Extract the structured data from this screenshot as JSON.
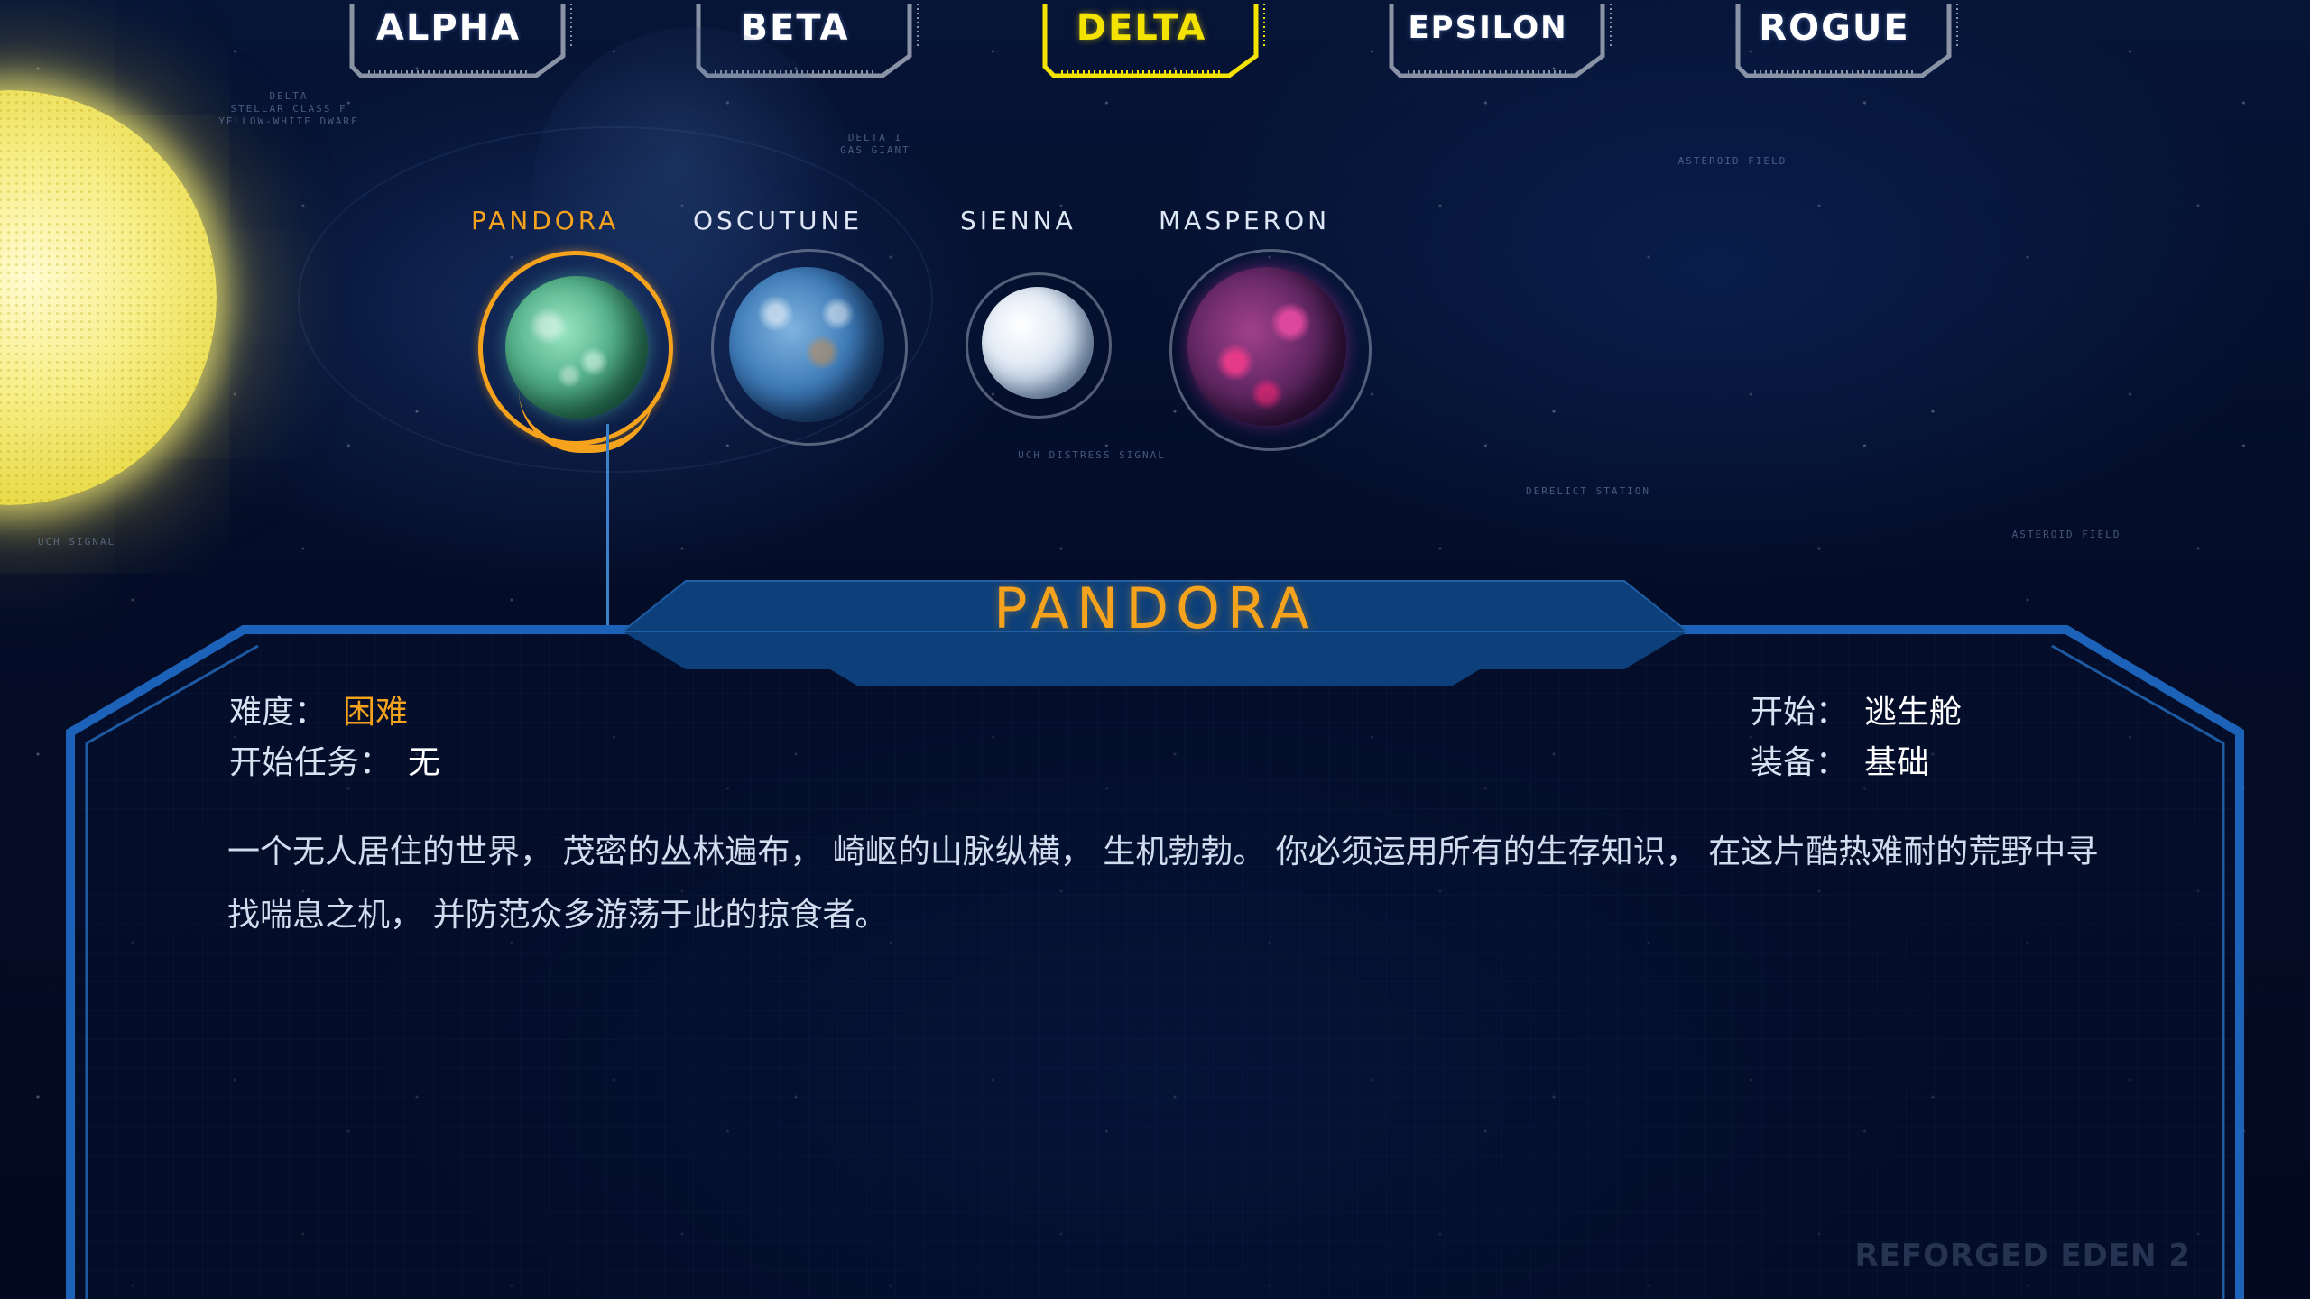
{
  "systems": [
    {
      "label": "ALPHA",
      "active": false
    },
    {
      "label": "BETA",
      "active": false
    },
    {
      "label": "DELTA",
      "active": true
    },
    {
      "label": "EPSILON",
      "active": false
    },
    {
      "label": "ROGUE",
      "active": false
    }
  ],
  "map_labels": {
    "star": "DELTA\nSTELLAR CLASS F\nYELLOW-WHITE DWARF",
    "gas_giant": "DELTA I\nGAS GIANT",
    "asteroid_field_1": "ASTEROID FIELD",
    "asteroid_field_2": "ASTEROID FIELD",
    "derelict_station": "DERELICT STATION",
    "uch_distress": "UCH DISTRESS SIGNAL",
    "uch_signal": "UCH SIGNAL"
  },
  "planets": [
    {
      "name": "PANDORA",
      "selected": true
    },
    {
      "name": "OSCUTUNE",
      "selected": false
    },
    {
      "name": "SIENNA",
      "selected": false
    },
    {
      "name": "MASPERON",
      "selected": false
    }
  ],
  "details": {
    "title": "PANDORA",
    "difficulty_label": "难度：",
    "difficulty_value": "困难",
    "start_mission_label": "开始任务：",
    "start_mission_value": "无",
    "start_label": "开始：",
    "start_value": "逃生舱",
    "equipment_label": "装备：",
    "equipment_value": "基础",
    "description": "一个无人居住的世界， 茂密的丛林遍布， 崎岖的山脉纵横， 生机勃勃。 你必须运用所有的生存知识， 在这片酷热难耐的荒野中寻找喘息之机， 并防范众多游荡于此的掠食者。"
  },
  "watermark": "REFORGED EDEN 2",
  "colors": {
    "accent_orange": "#f5a21c",
    "active_tab_yellow": "#f4e300",
    "panel_frame_blue": "#1b62b8",
    "title_bar_blue": "#0d3f7a"
  }
}
